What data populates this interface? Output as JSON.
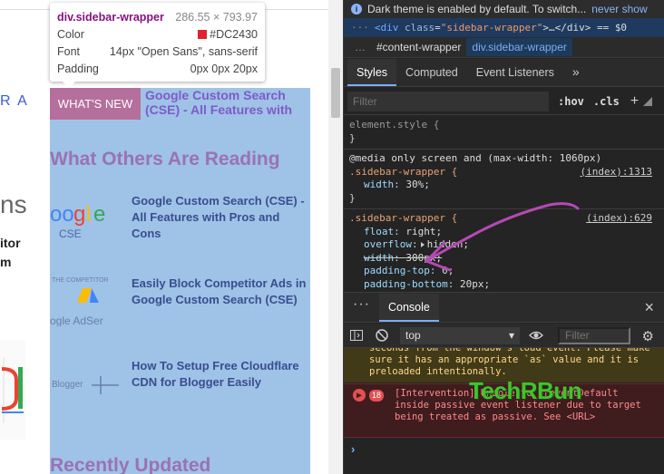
{
  "page": {
    "cut_text_ra": "R A",
    "cut_text_ns": "ns",
    "cut_text_itor": "itor",
    "cut_text_m": "m",
    "whats_new_label": "WHAT'S NEW",
    "whats_new_title": "Google Custom Search (CSE) - All Features with",
    "others_reading_heading": "What Others Are Reading",
    "posts": [
      {
        "title": "Google Custom Search (CSE) - All Features with Pros and Cons"
      },
      {
        "title": "Easily Block Competitor Ads in Google Custom Search (CSE)"
      },
      {
        "title": "How To Setup Free Cloudflare CDN for Blogger Easily"
      }
    ],
    "recently_updated_heading": "Recently Updated"
  },
  "tooltip": {
    "selector": "div.sidebar-wrapper",
    "dimensions": "286.55 × 793.97",
    "rows": [
      {
        "label": "Color",
        "value": "#DC2430"
      },
      {
        "label": "Font",
        "value": "14px \"Open Sans\", sans-serif"
      },
      {
        "label": "Padding",
        "value": "0px 0px 20px"
      }
    ],
    "swatch_color": "#DC2430"
  },
  "devtools": {
    "info_bar": {
      "message": "Dark theme is enabled by default. To switch...",
      "link": "never show"
    },
    "dom_line": {
      "tag_open": "<div",
      "attr": "class",
      "value": "\"sidebar-wrapper\"",
      "rest": ">…</div> == $0"
    },
    "breadcrumbs": [
      "#content-wrapper",
      "div.sidebar-wrapper"
    ],
    "tabs": [
      "Styles",
      "Computed",
      "Event Listeners",
      "»"
    ],
    "filter_placeholder": "Filter",
    "hov_label": ":hov",
    "cls_label": ".cls",
    "plus_label": "+",
    "rules": {
      "element_style": "element.style {",
      "close_brace": "}",
      "media": "@media only screen and (max-width: 1060px)",
      "rule1_selector": ".sidebar-wrapper {",
      "rule1_source": "(index):1313",
      "rule1_prop": "width",
      "rule1_val": "30%;",
      "rule2_selector": ".sidebar-wrapper {",
      "rule2_source": "(index):629",
      "rule2_props": [
        {
          "name": "float",
          "value": "right;"
        },
        {
          "name": "overflow",
          "value": "hidden;"
        },
        {
          "name": "width",
          "value": "300px;"
        },
        {
          "name": "padding-top",
          "value": "0;"
        },
        {
          "name": "padding-bottom",
          "value": "20px;"
        }
      ]
    },
    "console_tab": "Console",
    "context_value": "top",
    "console_filter_placeholder": "Filter",
    "warning_text": "seconds from the window's load event. Please make sure it has an appropriate `as` value and it is preloaded intentionally.",
    "error_count": "18",
    "error_text": "[Intervention] Unable to preventDefault inside passive event listener due to target being treated as passive. See <URL>",
    "prompt": "›"
  },
  "watermark": "TechRBun",
  "colors": {
    "sidebar_highlight": "#9fc2e7",
    "heading_purple": "#9a72b4",
    "annotation_arrow": "#b649b4",
    "devtools_bg": "#242424",
    "selector_orange": "#e8a274",
    "error_red": "#e35050"
  }
}
